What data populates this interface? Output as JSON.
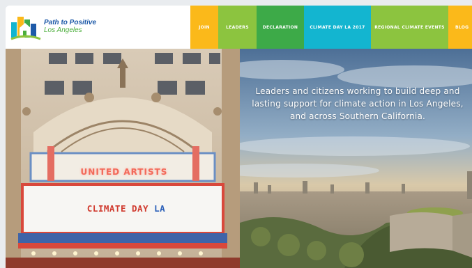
{
  "brand": {
    "name_line1": "Path to Positive",
    "name_line2": "Los Angeles",
    "colors": {
      "blue": "#1e5aa8",
      "green": "#4cae3c"
    }
  },
  "nav": {
    "items": [
      {
        "label": "JOIN",
        "color": "#fbb91a"
      },
      {
        "label": "LEADERS",
        "color": "#8cc43f"
      },
      {
        "label": "DECLARATION",
        "color": "#3daa48"
      },
      {
        "label": "CLIMATE DAY LA 2017",
        "color": "#13b5d0"
      },
      {
        "label": "REGIONAL CLIMATE EVENTS",
        "color": "#8cc43f"
      },
      {
        "label": "BLOG",
        "color": "#fbb91a"
      }
    ]
  },
  "hero": {
    "tagline": "Leaders and citizens working to build deep and lasting support for climate action in Los Angeles, and across Southern California.",
    "marquee_sign": "UNITED ARTISTS",
    "marquee_word1": "CLIMATE DAY",
    "marquee_word2": "LA"
  }
}
